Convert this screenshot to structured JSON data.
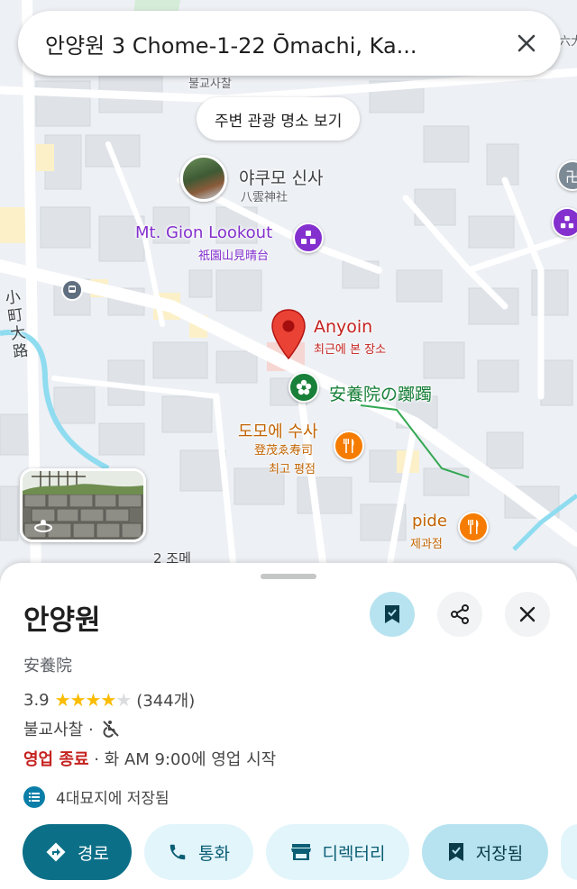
{
  "search": {
    "query": "안양원 3 Chome-1-22 Ōmachi, Ka..."
  },
  "map": {
    "nearby_chip": "주변 관광 명소 보기",
    "labels": {
      "temple_top": "불교사찰",
      "yakumo_name": "야쿠모 신사",
      "yakumo_sub": "八雲神社",
      "gion_name": "Mt. Gion Lookout",
      "gion_sub": "祇園山見晴台",
      "street_vertical": "小町大路",
      "anyoin_name": "Anyoin",
      "anyoin_sub": "최근에 본 장소",
      "azalea_name": "安養院の躑躅",
      "sushi_name": "도모에 수사",
      "sushi_sub1": "登茂ゑ寿司",
      "sushi_sub2": "최고 평점",
      "pide_name": "pide",
      "pide_sub": "제과점",
      "district": "2 조메",
      "corner_text": "六大"
    },
    "colors": {
      "pin_red": "#ea4335",
      "purple": "#8430ce",
      "green": "#188038",
      "orange": "#f57c00",
      "water": "#8fdcf0"
    }
  },
  "sheet": {
    "title": "안양원",
    "subtitle": "安養院",
    "rating": "3.9",
    "rating_value": 3.9,
    "review_count": "(344개)",
    "category": "불교사찰 ·",
    "hours_status": "영업 종료",
    "hours_detail": " · 화 AM 9:00에 영업 시작",
    "saved_list": "4대묘지에 저장됨",
    "actions": {
      "directions": "경로",
      "call": "통화",
      "directory": "디렉터리",
      "saved": "저장됨"
    }
  }
}
